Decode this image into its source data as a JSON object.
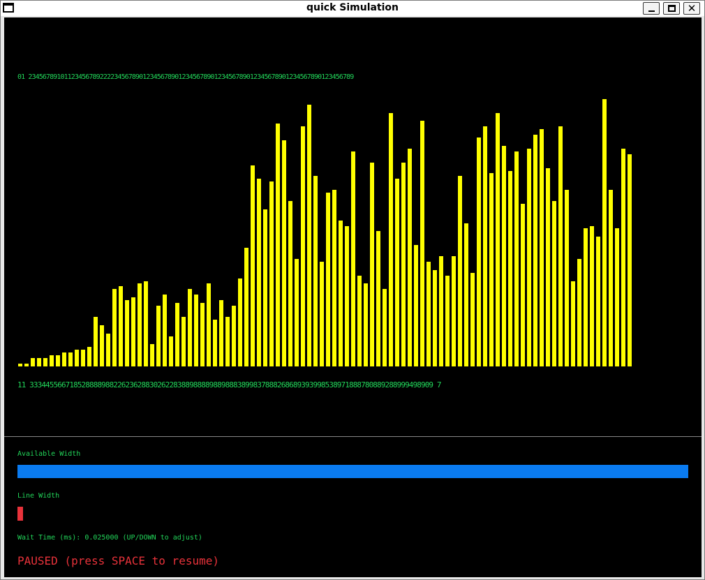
{
  "window": {
    "title": "quick Simulation",
    "buttons": {
      "minimize": "minimize",
      "maximize": "maximize",
      "close": "✕"
    }
  },
  "visualizer": {
    "index_labels": "01 2345678910112345678922223456789012345678901234567890123456789012345678901234567890123456789",
    "value_labels": "11 33344556671852888898822623628830262283889888898898883899837888268689393998538971888780889288999498909 7",
    "bar_color": "#ffff00",
    "label_color": "#22d65a"
  },
  "chart_data": {
    "type": "bar",
    "categories": [
      "0",
      "1",
      "2",
      "3",
      "4",
      "5",
      "6",
      "7",
      "8",
      "9",
      "10",
      "11",
      "12",
      "13",
      "14",
      "15",
      "16",
      "17",
      "18",
      "19",
      "20",
      "21",
      "22",
      "23",
      "24",
      "25",
      "26",
      "27",
      "28",
      "29",
      "30",
      "31",
      "32",
      "33",
      "34",
      "35",
      "36",
      "37",
      "38",
      "39",
      "40",
      "41",
      "42",
      "43",
      "44",
      "45",
      "46",
      "47",
      "48",
      "49",
      "50",
      "51",
      "52",
      "53",
      "54",
      "55",
      "56",
      "57",
      "58",
      "59",
      "60",
      "61",
      "62",
      "63",
      "64",
      "65",
      "66",
      "67",
      "68",
      "69",
      "70",
      "71",
      "72",
      "73",
      "74",
      "75",
      "76",
      "77",
      "78",
      "79",
      "80",
      "81",
      "82",
      "83",
      "84",
      "85",
      "86",
      "87",
      "88",
      "89",
      "90",
      "91",
      "92",
      "93",
      "94",
      "95",
      "96",
      "97",
      "98",
      "99"
    ],
    "values": [
      1,
      1,
      3,
      3,
      3,
      4,
      4,
      5,
      5,
      6,
      6,
      7,
      18,
      15,
      12,
      28,
      29,
      24,
      25,
      30,
      31,
      8,
      22,
      26,
      11,
      23,
      18,
      28,
      26,
      23,
      30,
      17,
      24,
      18,
      22,
      32,
      43,
      73,
      68,
      57,
      67,
      88,
      82,
      60,
      39,
      87,
      95,
      69,
      38,
      63,
      64,
      53,
      51,
      78,
      33,
      30,
      74,
      49,
      28,
      92,
      68,
      74,
      79,
      44,
      89,
      38,
      35,
      40,
      33,
      40,
      69,
      52,
      34,
      83,
      87,
      70,
      92,
      80,
      71,
      78,
      59,
      79,
      84,
      86,
      72,
      60,
      87,
      64,
      31,
      39,
      50,
      51,
      47,
      97,
      64,
      50,
      79,
      77
    ],
    "title": "",
    "xlabel": "",
    "ylabel": "",
    "ylim": [
      0,
      100
    ]
  },
  "controls": {
    "available_width_label": "Available Width",
    "available_width_fraction": 1.0,
    "available_width_color": "#0a7bf0",
    "line_width_label": "Line Width",
    "line_width_color": "#e8323a",
    "wait_time_text": "Wait Time (ms): 0.025000 (UP/DOWN to adjust)",
    "paused_text": "PAUSED (press SPACE to resume)",
    "paused_color": "#e8323a"
  }
}
